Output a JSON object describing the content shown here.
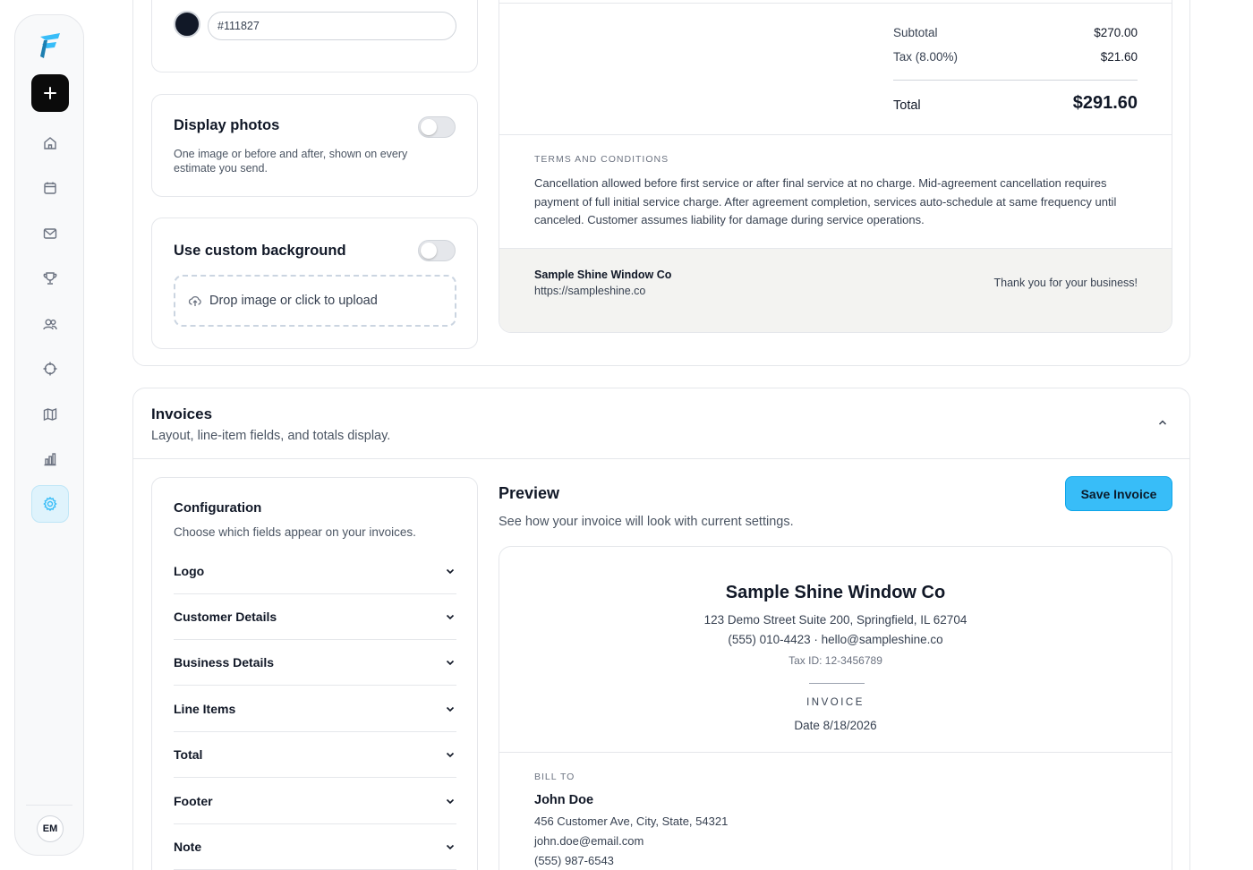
{
  "sidebar": {
    "avatar_initials": "EM",
    "nav_items": [
      {
        "name": "home"
      },
      {
        "name": "calendar"
      },
      {
        "name": "mail"
      },
      {
        "name": "trophy"
      },
      {
        "name": "users"
      },
      {
        "name": "target"
      },
      {
        "name": "map"
      },
      {
        "name": "chart"
      },
      {
        "name": "settings",
        "active": true
      }
    ]
  },
  "estimate_settings": {
    "text_color_value": "#111827",
    "display_photos": {
      "title": "Display photos",
      "description": "One image or before and after, shown on every estimate you send.",
      "enabled": false
    },
    "custom_background": {
      "title": "Use custom background",
      "enabled": false,
      "upload_label": "Drop image or click to upload"
    }
  },
  "estimate_preview": {
    "subtotal_label": "Subtotal",
    "subtotal_value": "$270.00",
    "tax_label": "Tax (8.00%)",
    "tax_value": "$21.60",
    "total_label": "Total",
    "total_value": "$291.60",
    "terms_heading": "TERMS AND CONDITIONS",
    "terms_text": "Cancellation allowed before first service or after final service at no charge. Mid-agreement cancellation requires payment of full initial service charge. After agreement completion, services auto-schedule at same frequency until canceled. Customer assumes liability for damage during service operations.",
    "footer_business": "Sample Shine Window Co",
    "footer_url": "https://sampleshine.co",
    "footer_thanks": "Thank you for your business!"
  },
  "invoices": {
    "title": "Invoices",
    "description": "Layout, line-item fields, and totals display.",
    "configuration": {
      "title": "Configuration",
      "description": "Choose which fields appear on your invoices.",
      "items": [
        "Logo",
        "Customer Details",
        "Business Details",
        "Line Items",
        "Total",
        "Footer",
        "Note"
      ]
    },
    "preview": {
      "title": "Preview",
      "description": "See how your invoice will look with current settings.",
      "save_label": "Save Invoice",
      "business_name": "Sample Shine Window Co",
      "address": "123 Demo Street Suite 200, Springfield, IL 62704",
      "contact": "(555) 010-4423 · hello@sampleshine.co",
      "tax_id": "Tax ID: 12-3456789",
      "doc_label": "INVOICE",
      "date": "Date 8/18/2026",
      "bill_to_heading": "BILL TO",
      "customer_name": "John Doe",
      "customer_address": "456 Customer Ave, City, State, 54321",
      "customer_email": "john.doe@email.com",
      "customer_phone": "(555) 987-6543"
    }
  },
  "colors": {
    "accent": "#38bdf8",
    "active_nav": "#dff3fc",
    "logo": "#38bdf8"
  }
}
